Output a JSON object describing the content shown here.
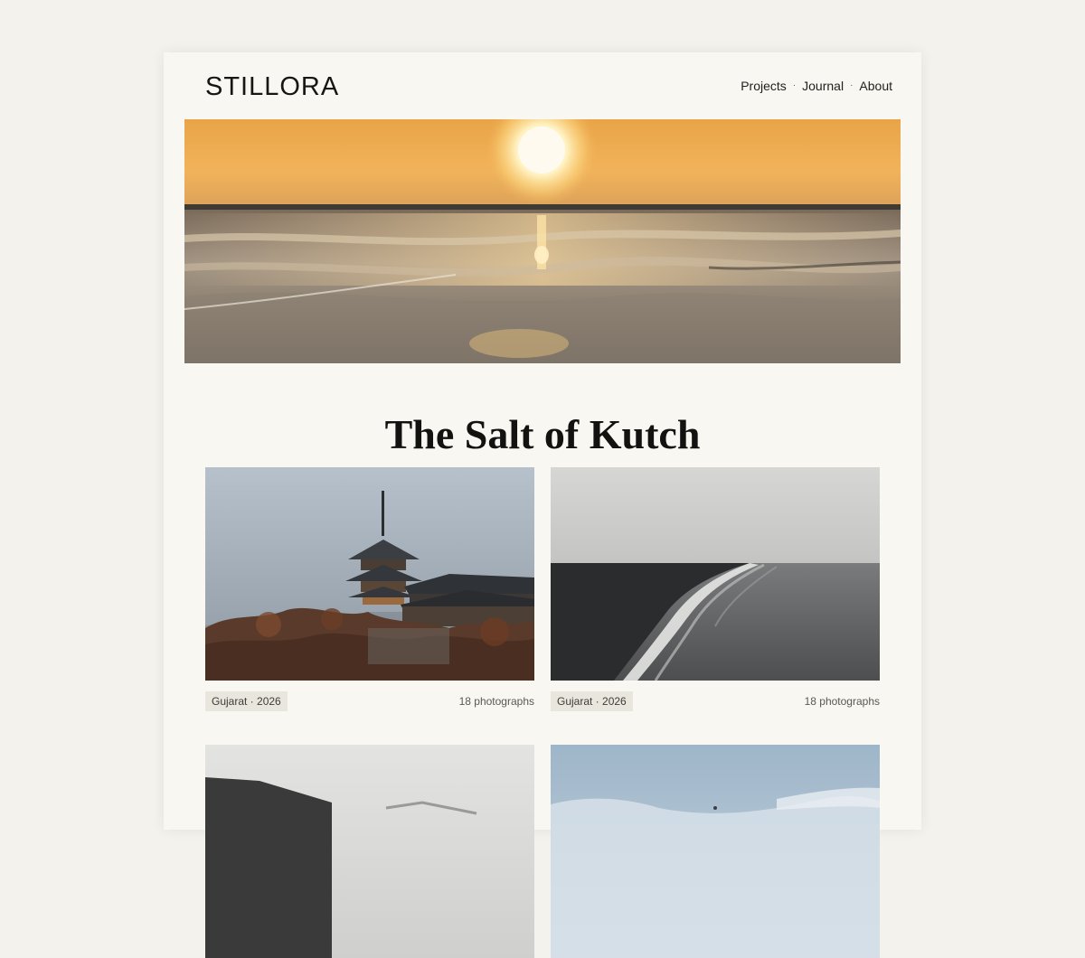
{
  "brand": {
    "logo": "STILLORA"
  },
  "nav": {
    "items": [
      "Projects",
      "Journal",
      "About"
    ],
    "separator": "·"
  },
  "hero": {
    "image": "sunset-over-salt-flats",
    "title": "The Salt of Kutch"
  },
  "cards": [
    {
      "image": "pagoda-in-mist",
      "tag": "Gujarat · 2026",
      "count": "18 photographs"
    },
    {
      "image": "black-sand-beach",
      "tag": "Gujarat · 2026",
      "count": "18 photographs"
    },
    {
      "image": "rocky-coast-mist",
      "tag": "",
      "count": ""
    },
    {
      "image": "misty-blue-shore",
      "tag": "",
      "count": ""
    }
  ],
  "colors": {
    "background": "#f3f2ed",
    "page": "#f8f7f2",
    "tag": "#e9e6de",
    "sun": "#f0a93a"
  }
}
